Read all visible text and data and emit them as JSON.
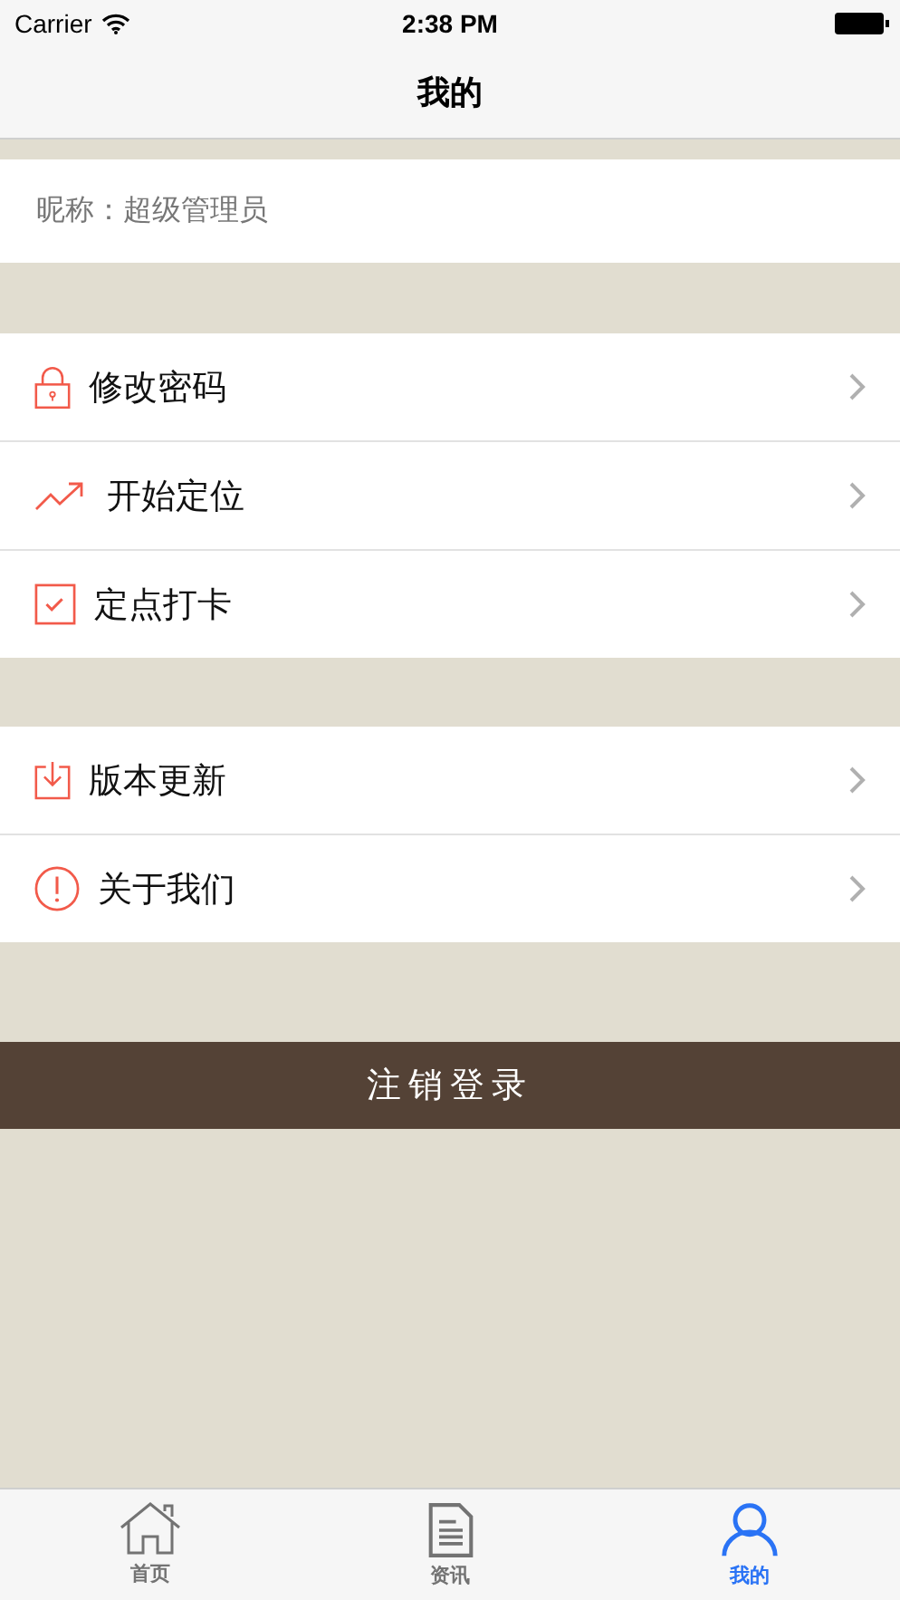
{
  "status_bar": {
    "carrier": "Carrier",
    "time": "2:38 PM"
  },
  "nav": {
    "title": "我的"
  },
  "profile": {
    "nickname": "昵称：超级管理员"
  },
  "menu_groups": [
    {
      "items": [
        {
          "kind": "lock",
          "label": "修改密码"
        },
        {
          "kind": "trend",
          "label": "开始定位"
        },
        {
          "kind": "check",
          "label": "定点打卡"
        }
      ]
    },
    {
      "items": [
        {
          "kind": "download",
          "label": "版本更新"
        },
        {
          "kind": "info",
          "label": "关于我们"
        }
      ]
    }
  ],
  "logout_button": "注销登录",
  "tabs": [
    {
      "kind": "home",
      "label": "首页",
      "selected": false
    },
    {
      "kind": "doc",
      "label": "资讯",
      "selected": false
    },
    {
      "kind": "user",
      "label": "我的",
      "selected": true
    }
  ]
}
